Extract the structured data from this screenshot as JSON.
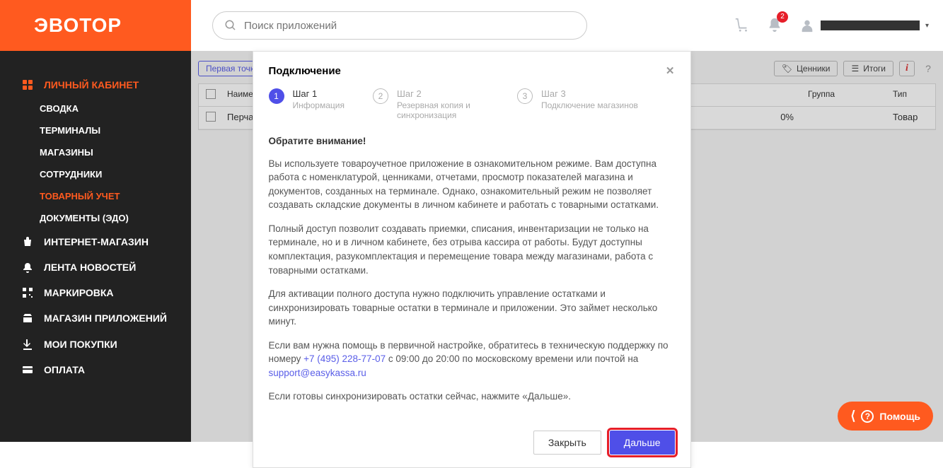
{
  "logo": "ЭВОТОР",
  "search_placeholder": "Поиск приложений",
  "notification_count": "2",
  "sidebar": {
    "main": {
      "label": "ЛИЧНЫЙ КАБИНЕТ"
    },
    "subs": [
      {
        "label": "СВОДКА"
      },
      {
        "label": "ТЕРМИНАЛЫ"
      },
      {
        "label": "МАГАЗИНЫ"
      },
      {
        "label": "СОТРУДНИКИ"
      },
      {
        "label": "ТОВАРНЫЙ УЧЕТ"
      },
      {
        "label": "ДОКУМЕНТЫ (ЭДО)"
      }
    ],
    "items": [
      {
        "label": "ИНТЕРНЕТ-МАГАЗИН"
      },
      {
        "label": "ЛЕНТА НОВОСТЕЙ"
      },
      {
        "label": "МАРКИРОВКА"
      },
      {
        "label": "МАГАЗИН ПРИЛОЖЕНИЙ"
      },
      {
        "label": "МОИ ПОКУПКИ"
      },
      {
        "label": "ОПЛАТА"
      }
    ]
  },
  "toolbar": {
    "chip": "Первая точка",
    "prices": "Ценники",
    "totals": "Итоги"
  },
  "table": {
    "headers": {
      "name": "Наименование",
      "group": "Группа",
      "type": "Тип"
    },
    "row": {
      "name": "Перчатки защитн",
      "percent": "0%",
      "type": "Товар"
    }
  },
  "modal": {
    "title": "Подключение",
    "steps": [
      {
        "num": "1",
        "title": "Шаг 1",
        "sub": "Информация"
      },
      {
        "num": "2",
        "title": "Шаг 2",
        "sub": "Резервная копия и синхронизация"
      },
      {
        "num": "3",
        "title": "Шаг 3",
        "sub": "Подключение магазинов"
      }
    ],
    "heading": "Обратите внимание!",
    "p1": "Вы используете товароучетное приложение в ознакомительном режиме. Вам доступна работа с номенклатурой, ценниками, отчетами, просмотр показателей магазина и документов, созданных на терминале. Однако, ознакомительный режим не позволяет создавать складские документы в личном кабинете и работать с товарными остатками.",
    "p2": "Полный доступ позволит создавать приемки, списания, инвентаризации не только на терминале, но и в личном кабинете, без отрыва кассира от работы. Будут доступны комплектация, разукомплектация и перемещение товара между магазинами, работа с товарными остатками.",
    "p3": "Для активации полного доступа нужно подключить управление остатками и синхронизировать товарные остатки в терминале и приложении. Это займет несколько минут.",
    "p4_before": "Если вам нужна помощь в первичной настройке, обратитесь в техническую поддержку по номеру ",
    "phone": "+7 (495) 228-77-07",
    "p4_mid": " с 09:00 до 20:00 по московскому времени или почтой на ",
    "email": "support@easykassa.ru",
    "p5": "Если готовы синхронизировать остатки сейчас, нажмите «Дальше».",
    "close": "Закрыть",
    "next": "Дальше"
  },
  "help": "Помощь"
}
